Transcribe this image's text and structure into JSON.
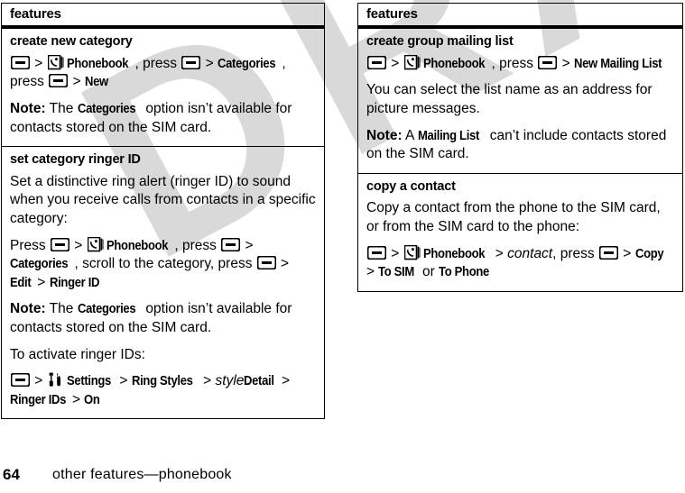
{
  "page": {
    "number": "64",
    "footer_title": "other features—phonebook",
    "watermark": "DRAFT"
  },
  "icons": {
    "menu": "menu-key-icon",
    "phonebook": "phonebook-icon",
    "settings": "settings-tools-icon"
  },
  "left_column": {
    "header": "features",
    "rows": [
      {
        "title": "create new category",
        "blocks": [
          {
            "type": "steps",
            "parts": [
              {
                "t": "icon",
                "v": "menu"
              },
              {
                "t": "gt",
                "v": " > "
              },
              {
                "t": "icon",
                "v": "phonebook"
              },
              {
                "t": "kw",
                "v": "Phonebook"
              },
              {
                "t": "plain",
                "v": ", press "
              },
              {
                "t": "icon",
                "v": "menu"
              },
              {
                "t": "gt",
                "v": " > "
              },
              {
                "t": "kw",
                "v": "Categories"
              },
              {
                "t": "plain",
                "v": ", press "
              },
              {
                "t": "icon",
                "v": "menu"
              },
              {
                "t": "gt",
                "v": " > "
              },
              {
                "t": "kw",
                "v": "New"
              }
            ]
          },
          {
            "type": "note",
            "parts": [
              {
                "t": "nb",
                "v": "Note:"
              },
              {
                "t": "plain",
                "v": " The "
              },
              {
                "t": "kw",
                "v": "Categories"
              },
              {
                "t": "plain",
                "v": " option isn’t available for contacts stored on the SIM card."
              }
            ]
          }
        ]
      },
      {
        "title": "set category ringer ID",
        "blocks": [
          {
            "type": "plain",
            "parts": [
              {
                "t": "plain",
                "v": "Set a distinctive ring alert (ringer ID) to sound when you receive calls from contacts in a specific category:"
              }
            ]
          },
          {
            "type": "steps",
            "parts": [
              {
                "t": "plain",
                "v": "Press "
              },
              {
                "t": "icon",
                "v": "menu"
              },
              {
                "t": "gt",
                "v": " > "
              },
              {
                "t": "icon",
                "v": "phonebook"
              },
              {
                "t": "kw",
                "v": "Phonebook"
              },
              {
                "t": "plain",
                "v": ", press "
              },
              {
                "t": "icon",
                "v": "menu"
              },
              {
                "t": "gt",
                "v": " > "
              },
              {
                "t": "kw",
                "v": "Categories"
              },
              {
                "t": "plain",
                "v": ", scroll to the category, press "
              },
              {
                "t": "icon",
                "v": "menu"
              },
              {
                "t": "gt",
                "v": " > "
              },
              {
                "t": "kw",
                "v": "Edit"
              },
              {
                "t": "gt",
                "v": " > "
              },
              {
                "t": "kw",
                "v": "Ringer ID"
              }
            ]
          },
          {
            "type": "note",
            "parts": [
              {
                "t": "nb",
                "v": "Note:"
              },
              {
                "t": "plain",
                "v": " The "
              },
              {
                "t": "kw",
                "v": "Categories"
              },
              {
                "t": "plain",
                "v": " option isn’t available for contacts stored on the SIM card."
              }
            ]
          },
          {
            "type": "plain",
            "parts": [
              {
                "t": "plain",
                "v": "To activate ringer IDs:"
              }
            ]
          },
          {
            "type": "steps",
            "parts": [
              {
                "t": "icon",
                "v": "menu"
              },
              {
                "t": "gt",
                "v": " > "
              },
              {
                "t": "icon",
                "v": "settings"
              },
              {
                "t": "kw",
                "v": "Settings"
              },
              {
                "t": "gt",
                "v": " > "
              },
              {
                "t": "kw",
                "v": "Ring Styles"
              },
              {
                "t": "gt",
                "v": " > "
              },
              {
                "t": "it",
                "v": "style"
              },
              {
                "t": "kw",
                "v": " Detail"
              },
              {
                "t": "gt",
                "v": " > "
              },
              {
                "t": "kw",
                "v": "Ringer IDs"
              },
              {
                "t": "gt",
                "v": "> "
              },
              {
                "t": "kw",
                "v": "On"
              }
            ]
          }
        ]
      }
    ]
  },
  "right_column": {
    "header": "features",
    "rows": [
      {
        "title": "create group mailing list",
        "blocks": [
          {
            "type": "steps",
            "parts": [
              {
                "t": "icon",
                "v": "menu"
              },
              {
                "t": "gt",
                "v": " > "
              },
              {
                "t": "icon",
                "v": "phonebook"
              },
              {
                "t": "kw",
                "v": "Phonebook"
              },
              {
                "t": "plain",
                "v": ", press "
              },
              {
                "t": "icon",
                "v": "menu"
              },
              {
                "t": "gt",
                "v": " > "
              },
              {
                "t": "kw",
                "v": "New Mailing List"
              }
            ]
          },
          {
            "type": "plain",
            "parts": [
              {
                "t": "plain",
                "v": "You can select the list name as an address for picture messages."
              }
            ]
          },
          {
            "type": "note",
            "parts": [
              {
                "t": "nb",
                "v": "Note:"
              },
              {
                "t": "plain",
                "v": " A "
              },
              {
                "t": "kw",
                "v": "Mailing List"
              },
              {
                "t": "plain",
                "v": " can’t include contacts stored on the SIM card."
              }
            ]
          }
        ]
      },
      {
        "title": "copy a contact",
        "blocks": [
          {
            "type": "plain",
            "parts": [
              {
                "t": "plain",
                "v": "Copy a contact from the phone to the SIM card, or from the SIM card to the phone:"
              }
            ]
          },
          {
            "type": "steps",
            "parts": [
              {
                "t": "icon",
                "v": "menu"
              },
              {
                "t": "gt",
                "v": " > "
              },
              {
                "t": "icon",
                "v": "phonebook"
              },
              {
                "t": "kw",
                "v": "Phonebook"
              },
              {
                "t": "gt",
                "v": " > "
              },
              {
                "t": "it",
                "v": "contact"
              },
              {
                "t": "plain",
                "v": ", press "
              },
              {
                "t": "icon",
                "v": "menu"
              },
              {
                "t": "gt",
                "v": " > "
              },
              {
                "t": "kw",
                "v": "Copy"
              },
              {
                "t": "gt",
                "v": " > "
              },
              {
                "t": "kw",
                "v": "To SIM"
              },
              {
                "t": "plain",
                "v": " or "
              },
              {
                "t": "kw",
                "v": "To Phone"
              }
            ]
          }
        ]
      }
    ]
  }
}
